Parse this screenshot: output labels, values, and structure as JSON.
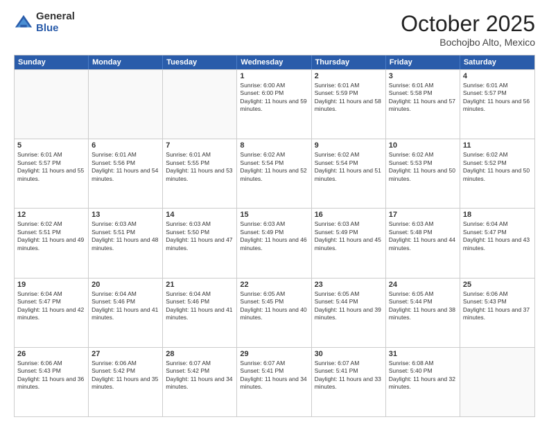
{
  "header": {
    "logo_general": "General",
    "logo_blue": "Blue",
    "month_title": "October 2025",
    "location": "Bochojbo Alto, Mexico"
  },
  "days_of_week": [
    "Sunday",
    "Monday",
    "Tuesday",
    "Wednesday",
    "Thursday",
    "Friday",
    "Saturday"
  ],
  "weeks": [
    [
      {
        "date": "",
        "empty": true
      },
      {
        "date": "",
        "empty": true
      },
      {
        "date": "",
        "empty": true
      },
      {
        "date": "1",
        "sunrise": "6:00 AM",
        "sunset": "6:00 PM",
        "daylight": "11 hours and 59 minutes."
      },
      {
        "date": "2",
        "sunrise": "6:01 AM",
        "sunset": "5:59 PM",
        "daylight": "11 hours and 58 minutes."
      },
      {
        "date": "3",
        "sunrise": "6:01 AM",
        "sunset": "5:58 PM",
        "daylight": "11 hours and 57 minutes."
      },
      {
        "date": "4",
        "sunrise": "6:01 AM",
        "sunset": "5:57 PM",
        "daylight": "11 hours and 56 minutes."
      }
    ],
    [
      {
        "date": "5",
        "sunrise": "6:01 AM",
        "sunset": "5:57 PM",
        "daylight": "11 hours and 55 minutes."
      },
      {
        "date": "6",
        "sunrise": "6:01 AM",
        "sunset": "5:56 PM",
        "daylight": "11 hours and 54 minutes."
      },
      {
        "date": "7",
        "sunrise": "6:01 AM",
        "sunset": "5:55 PM",
        "daylight": "11 hours and 53 minutes."
      },
      {
        "date": "8",
        "sunrise": "6:02 AM",
        "sunset": "5:54 PM",
        "daylight": "11 hours and 52 minutes."
      },
      {
        "date": "9",
        "sunrise": "6:02 AM",
        "sunset": "5:54 PM",
        "daylight": "11 hours and 51 minutes."
      },
      {
        "date": "10",
        "sunrise": "6:02 AM",
        "sunset": "5:53 PM",
        "daylight": "11 hours and 50 minutes."
      },
      {
        "date": "11",
        "sunrise": "6:02 AM",
        "sunset": "5:52 PM",
        "daylight": "11 hours and 50 minutes."
      }
    ],
    [
      {
        "date": "12",
        "sunrise": "6:02 AM",
        "sunset": "5:51 PM",
        "daylight": "11 hours and 49 minutes."
      },
      {
        "date": "13",
        "sunrise": "6:03 AM",
        "sunset": "5:51 PM",
        "daylight": "11 hours and 48 minutes."
      },
      {
        "date": "14",
        "sunrise": "6:03 AM",
        "sunset": "5:50 PM",
        "daylight": "11 hours and 47 minutes."
      },
      {
        "date": "15",
        "sunrise": "6:03 AM",
        "sunset": "5:49 PM",
        "daylight": "11 hours and 46 minutes."
      },
      {
        "date": "16",
        "sunrise": "6:03 AM",
        "sunset": "5:49 PM",
        "daylight": "11 hours and 45 minutes."
      },
      {
        "date": "17",
        "sunrise": "6:03 AM",
        "sunset": "5:48 PM",
        "daylight": "11 hours and 44 minutes."
      },
      {
        "date": "18",
        "sunrise": "6:04 AM",
        "sunset": "5:47 PM",
        "daylight": "11 hours and 43 minutes."
      }
    ],
    [
      {
        "date": "19",
        "sunrise": "6:04 AM",
        "sunset": "5:47 PM",
        "daylight": "11 hours and 42 minutes."
      },
      {
        "date": "20",
        "sunrise": "6:04 AM",
        "sunset": "5:46 PM",
        "daylight": "11 hours and 41 minutes."
      },
      {
        "date": "21",
        "sunrise": "6:04 AM",
        "sunset": "5:46 PM",
        "daylight": "11 hours and 41 minutes."
      },
      {
        "date": "22",
        "sunrise": "6:05 AM",
        "sunset": "5:45 PM",
        "daylight": "11 hours and 40 minutes."
      },
      {
        "date": "23",
        "sunrise": "6:05 AM",
        "sunset": "5:44 PM",
        "daylight": "11 hours and 39 minutes."
      },
      {
        "date": "24",
        "sunrise": "6:05 AM",
        "sunset": "5:44 PM",
        "daylight": "11 hours and 38 minutes."
      },
      {
        "date": "25",
        "sunrise": "6:06 AM",
        "sunset": "5:43 PM",
        "daylight": "11 hours and 37 minutes."
      }
    ],
    [
      {
        "date": "26",
        "sunrise": "6:06 AM",
        "sunset": "5:43 PM",
        "daylight": "11 hours and 36 minutes."
      },
      {
        "date": "27",
        "sunrise": "6:06 AM",
        "sunset": "5:42 PM",
        "daylight": "11 hours and 35 minutes."
      },
      {
        "date": "28",
        "sunrise": "6:07 AM",
        "sunset": "5:42 PM",
        "daylight": "11 hours and 34 minutes."
      },
      {
        "date": "29",
        "sunrise": "6:07 AM",
        "sunset": "5:41 PM",
        "daylight": "11 hours and 34 minutes."
      },
      {
        "date": "30",
        "sunrise": "6:07 AM",
        "sunset": "5:41 PM",
        "daylight": "11 hours and 33 minutes."
      },
      {
        "date": "31",
        "sunrise": "6:08 AM",
        "sunset": "5:40 PM",
        "daylight": "11 hours and 32 minutes."
      },
      {
        "date": "",
        "empty": true
      }
    ]
  ],
  "labels": {
    "sunrise": "Sunrise:",
    "sunset": "Sunset:",
    "daylight": "Daylight:"
  }
}
